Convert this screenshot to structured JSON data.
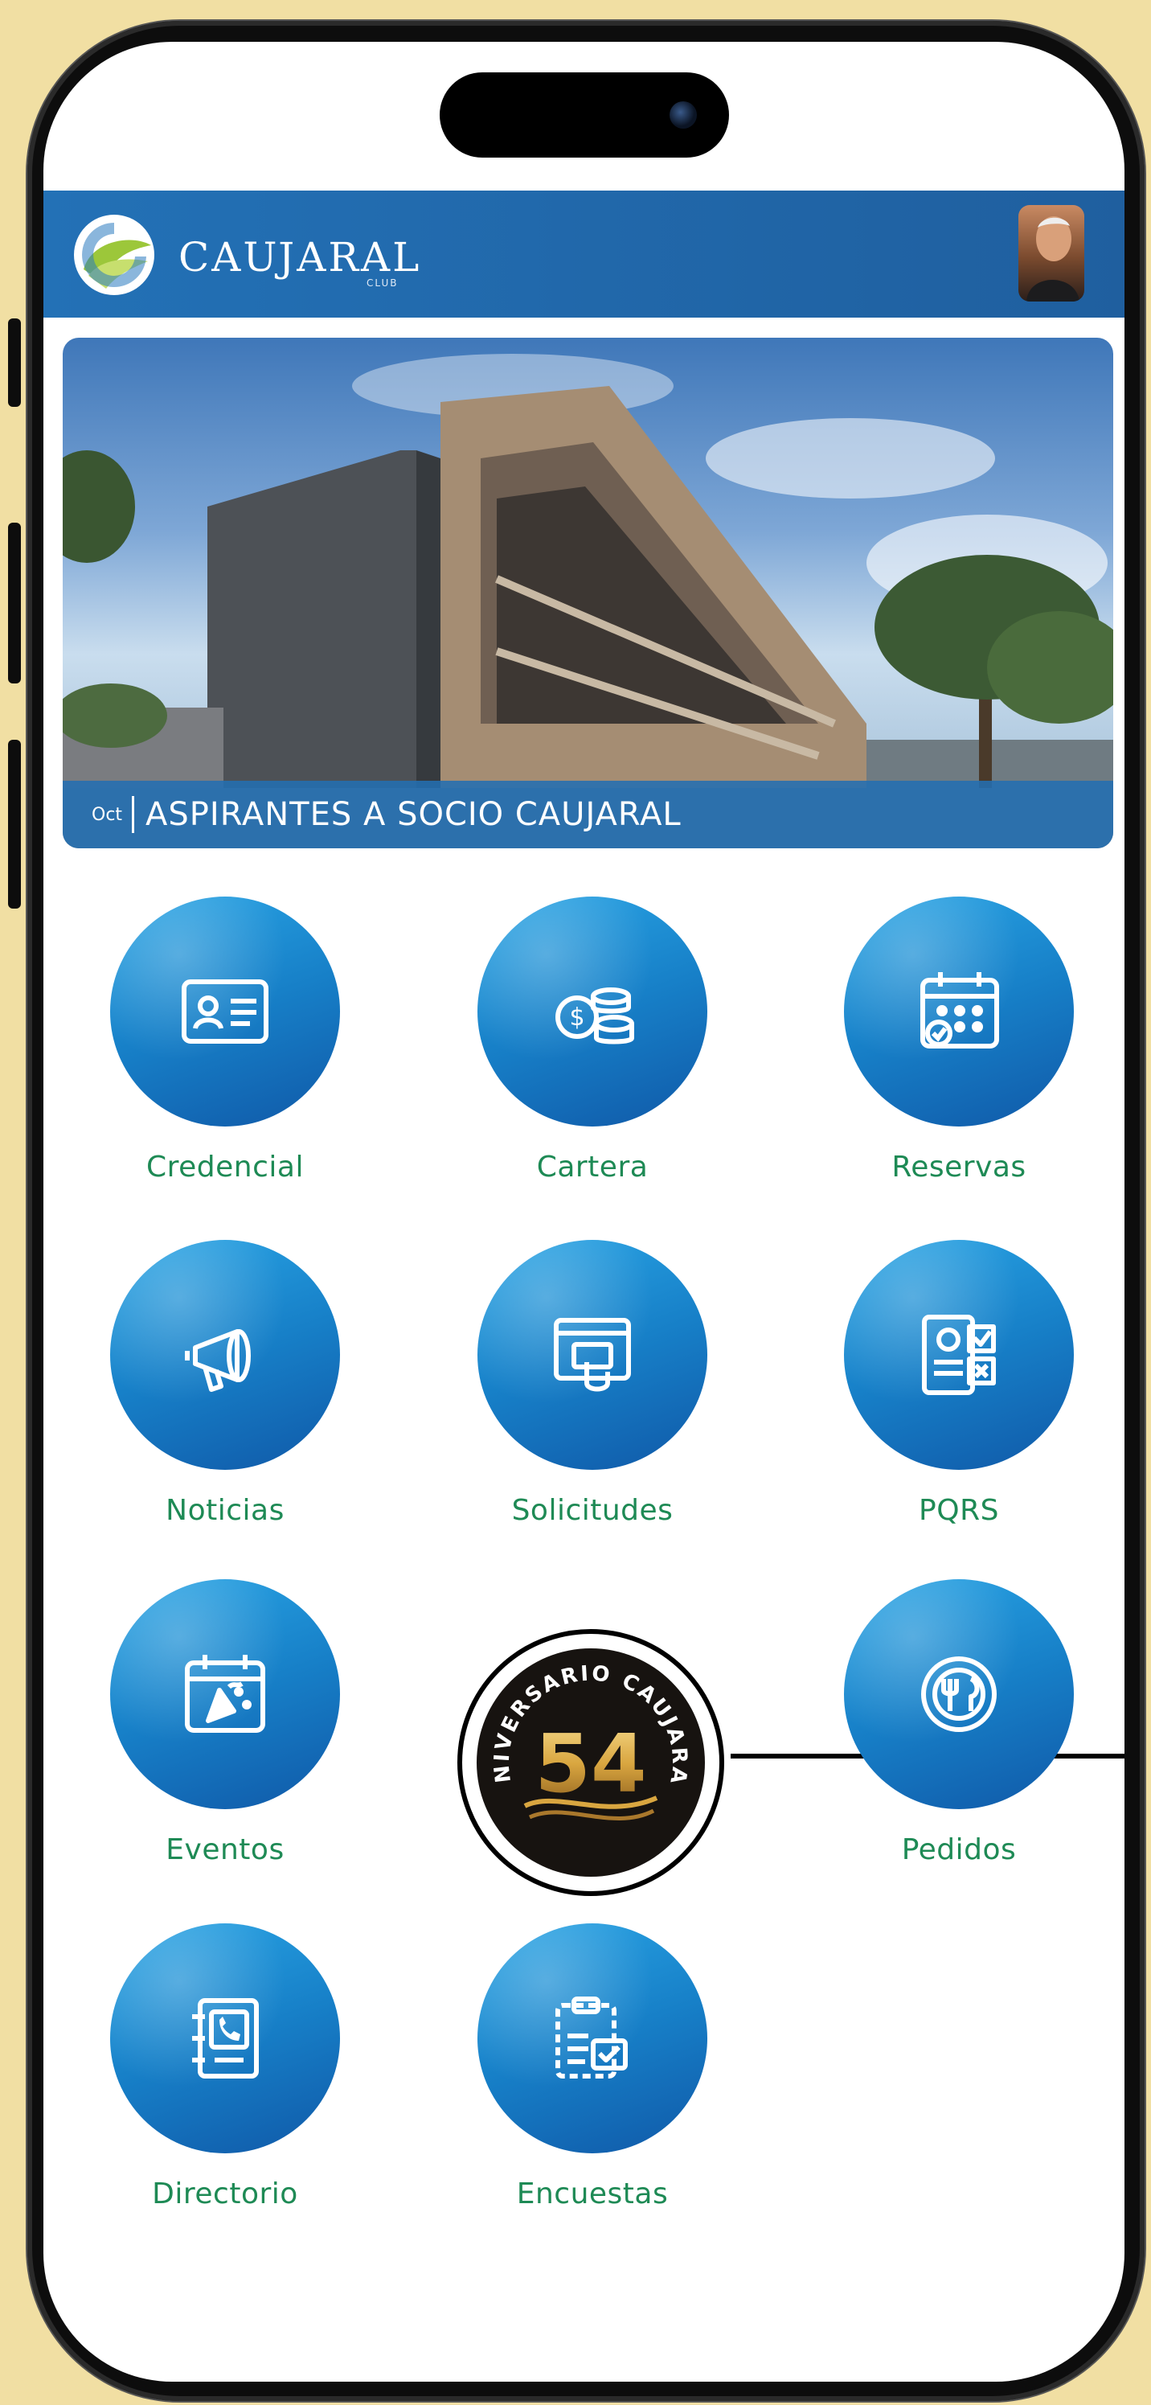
{
  "header": {
    "brand": "CAUJARAL",
    "brand_sub": "CLUB",
    "logo_icon": "caujaral-leaf-logo",
    "avatar_icon": "user-avatar"
  },
  "banner": {
    "month": "Oct",
    "title": "ASPIRANTES A SOCIO CAUJARAL"
  },
  "menu": [
    {
      "label": "Credencial",
      "icon": "id-card-icon"
    },
    {
      "label": "Cartera",
      "icon": "coins-dollar-icon"
    },
    {
      "label": "Reservas",
      "icon": "calendar-icon"
    },
    {
      "label": "Noticias",
      "icon": "megaphone-icon"
    },
    {
      "label": "Solicitudes",
      "icon": "request-form-icon"
    },
    {
      "label": "PQRS",
      "icon": "checklist-document-icon"
    },
    {
      "label": "Eventos",
      "icon": "party-calendar-icon"
    },
    {
      "label": "Pedidos",
      "icon": "plate-cutlery-icon"
    },
    {
      "label": "Directorio",
      "icon": "phone-book-icon"
    },
    {
      "label": "Encuestas",
      "icon": "survey-clipboard-icon"
    }
  ],
  "anniversary": {
    "arc_text": "ANIVERSARIO CAUJARAL",
    "number": "54"
  },
  "colors": {
    "accent_blue": "#1f6db4",
    "label_green": "#1e8a55",
    "background": "#f1dfa3"
  }
}
